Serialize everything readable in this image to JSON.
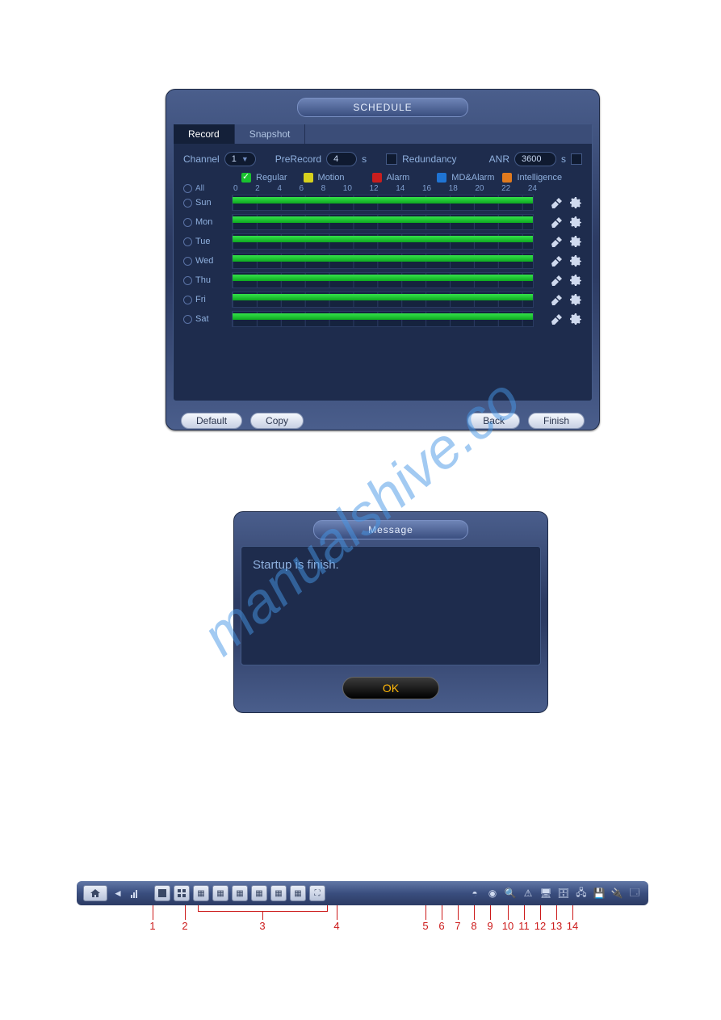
{
  "schedule": {
    "title": "SCHEDULE",
    "tabs": {
      "record": "Record",
      "snapshot": "Snapshot"
    },
    "channel_label": "Channel",
    "channel_value": "1",
    "prerecord_label": "PreRecord",
    "prerecord_value": "4",
    "seconds_suffix": "s",
    "redundancy_label": "Redundancy",
    "anr_label": "ANR",
    "anr_value": "3600",
    "legend": {
      "regular": "Regular",
      "motion": "Motion",
      "alarm": "Alarm",
      "mdalarm": "MD&Alarm",
      "intelligence": "Intelligence"
    },
    "all_label": "All",
    "scale": [
      "0",
      "2",
      "4",
      "6",
      "8",
      "10",
      "12",
      "14",
      "16",
      "18",
      "20",
      "22",
      "24"
    ],
    "days": [
      "Sun",
      "Mon",
      "Tue",
      "Wed",
      "Thu",
      "Fri",
      "Sat"
    ],
    "buttons": {
      "default": "Default",
      "copy": "Copy",
      "back": "Back",
      "finish": "Finish"
    }
  },
  "message": {
    "title": "Message",
    "body": "Startup is finish.",
    "ok": "OK"
  },
  "toolbar": {
    "annotations": [
      "1",
      "2",
      "3",
      "4",
      "5",
      "6",
      "7",
      "8",
      "9",
      "10",
      "11",
      "12",
      "13",
      "14"
    ]
  },
  "watermark": "manualshive.co"
}
